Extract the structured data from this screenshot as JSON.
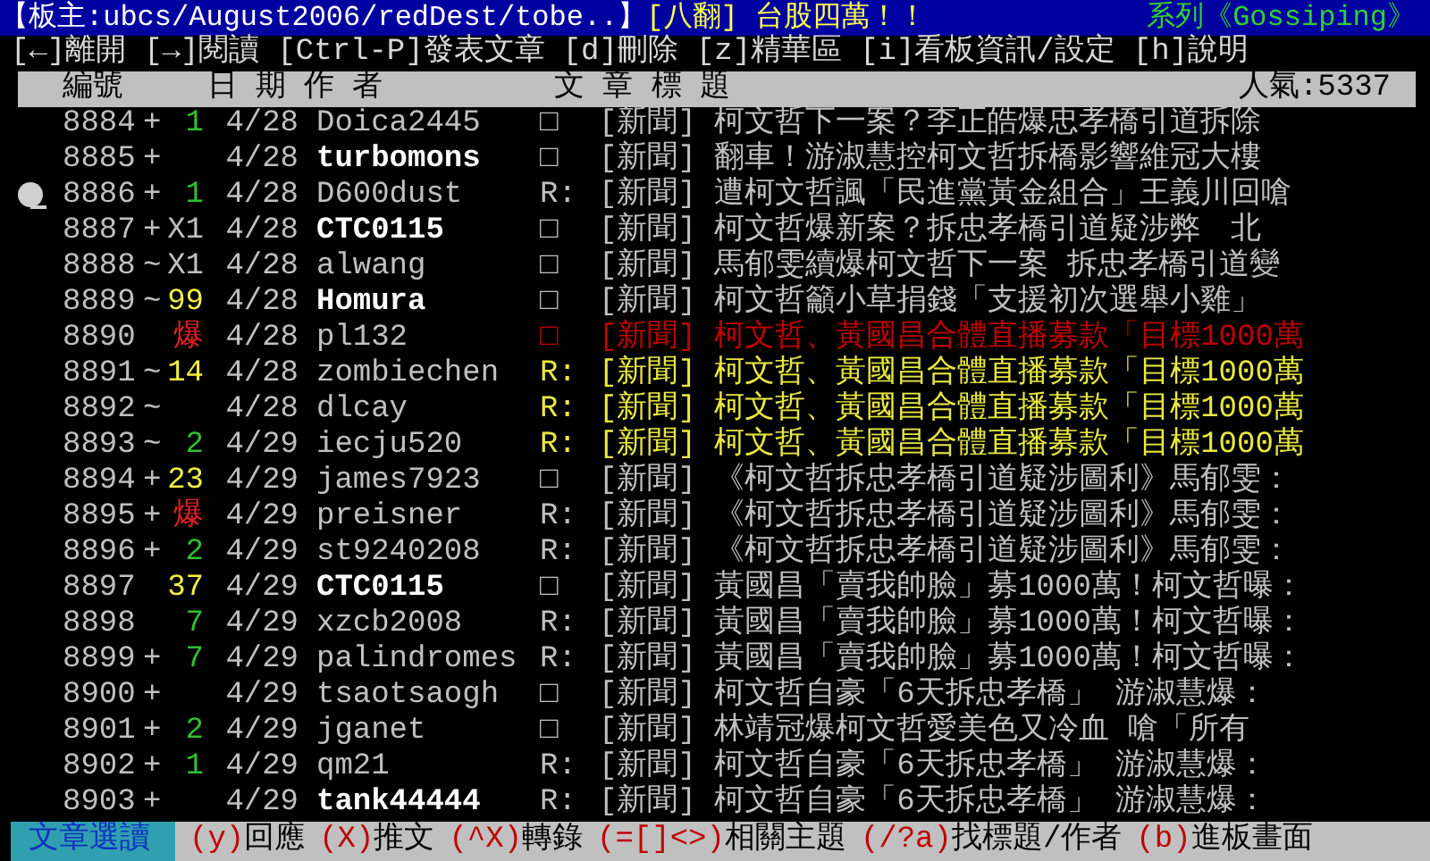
{
  "title_bar": {
    "moderator": "【板主:ubcs/August2006/redDest/tobe..】",
    "board_title": "[八翻] 台股四萬！！",
    "series": "系列《Gossiping》"
  },
  "menu": [
    "[←]離開",
    "[→]閱讀",
    "[Ctrl-P]發表文章",
    "[d]刪除",
    "[z]精華區",
    "[i]看板資訊/設定",
    "[h]說明"
  ],
  "header": {
    "number": "編號",
    "date": "日 期",
    "author": "作 者",
    "title": "文 章 標 題",
    "popularity": "人氣:5337"
  },
  "rows": [
    {
      "number": "8884",
      "push": {
        "mark": "+",
        "count": "1",
        "color": "#30c030"
      },
      "date": "4/28",
      "author": "Doica2445",
      "bright": false,
      "selected": false,
      "title": {
        "prefix": "□",
        "text": "[新聞] 柯文哲下一案？李正皓爆忠孝橋引道拆除",
        "color": "#c0c0c0"
      }
    },
    {
      "number": "8885",
      "push": {
        "mark": "+"
      },
      "date": "4/28",
      "author": "turbomons",
      "bright": true,
      "selected": false,
      "title": {
        "prefix": "□",
        "text": "[新聞] 翻車！游淑慧控柯文哲拆橋影響維冠大樓",
        "color": "#c0c0c0"
      }
    },
    {
      "number": "8886",
      "push": {
        "mark": "+",
        "count": "1",
        "color": "#30c030"
      },
      "date": "4/28",
      "author": "D600dust",
      "bright": false,
      "selected": true,
      "title": {
        "prefix": "R:",
        "text": "[新聞] 遭柯文哲諷「民進黨黃金組合」王義川回嗆",
        "color": "#c0c0c0"
      }
    },
    {
      "number": "8887",
      "push": {
        "mark": "+",
        "count": "X1",
        "color": "#c0c0c0"
      },
      "date": "4/28",
      "author": "CTC0115",
      "bright": true,
      "selected": false,
      "title": {
        "prefix": "□",
        "text": "[新聞] 柯文哲爆新案？拆忠孝橋引道疑涉弊　北",
        "color": "#c0c0c0"
      }
    },
    {
      "number": "8888",
      "push": {
        "mark": "~",
        "count": "X1",
        "color": "#c0c0c0"
      },
      "date": "4/28",
      "author": "alwang",
      "bright": false,
      "selected": false,
      "title": {
        "prefix": "□",
        "text": "[新聞] 馬郁雯續爆柯文哲下一案 拆忠孝橋引道變",
        "color": "#c0c0c0"
      }
    },
    {
      "number": "8889",
      "push": {
        "mark": "~",
        "count": "99",
        "color": "#f0f040"
      },
      "date": "4/28",
      "author": "Homura",
      "bright": true,
      "selected": false,
      "title": {
        "prefix": "□",
        "text": "[新聞] 柯文哲籲小草捐錢「支援初次選舉小雞」",
        "color": "#c0c0c0"
      }
    },
    {
      "number": "8890",
      "push": {
        "count": "爆",
        "color": "#e02020"
      },
      "date": "4/28",
      "author": "pl132",
      "bright": false,
      "selected": false,
      "title": {
        "prefix": "□",
        "text": "[新聞] 柯文哲、黃國昌合體直播募款「目標1000萬",
        "color": "#c00000"
      }
    },
    {
      "number": "8891",
      "push": {
        "mark": "~",
        "count": "14",
        "color": "#f0f040"
      },
      "date": "4/28",
      "author": "zombiechen",
      "bright": false,
      "selected": false,
      "title": {
        "prefix": "R:",
        "text": "[新聞] 柯文哲、黃國昌合體直播募款「目標1000萬",
        "color": "#e8e840"
      }
    },
    {
      "number": "8892",
      "push": {
        "mark": "~"
      },
      "date": "4/28",
      "author": "dlcay",
      "bright": false,
      "selected": false,
      "title": {
        "prefix": "R:",
        "text": "[新聞] 柯文哲、黃國昌合體直播募款「目標1000萬",
        "color": "#e8e840"
      }
    },
    {
      "number": "8893",
      "push": {
        "mark": "~",
        "count": "2",
        "color": "#30c030"
      },
      "date": "4/29",
      "author": "iecju520",
      "bright": false,
      "selected": false,
      "title": {
        "prefix": "R:",
        "text": "[新聞] 柯文哲、黃國昌合體直播募款「目標1000萬",
        "color": "#e8e840"
      }
    },
    {
      "number": "8894",
      "push": {
        "mark": "+",
        "count": "23",
        "color": "#f0f040"
      },
      "date": "4/29",
      "author": "james7923",
      "bright": false,
      "selected": false,
      "title": {
        "prefix": "□",
        "text": "[新聞] 《柯文哲拆忠孝橋引道疑涉圖利》馬郁雯：",
        "color": "#c0c0c0"
      }
    },
    {
      "number": "8895",
      "push": {
        "mark": "+",
        "count": "爆",
        "color": "#e02020"
      },
      "date": "4/29",
      "author": "preisner",
      "bright": false,
      "selected": false,
      "title": {
        "prefix": "R:",
        "text": "[新聞] 《柯文哲拆忠孝橋引道疑涉圖利》馬郁雯：",
        "color": "#c0c0c0"
      }
    },
    {
      "number": "8896",
      "push": {
        "mark": "+",
        "count": "2",
        "color": "#30c030"
      },
      "date": "4/29",
      "author": "st9240208",
      "bright": false,
      "selected": false,
      "title": {
        "prefix": "R:",
        "text": "[新聞] 《柯文哲拆忠孝橋引道疑涉圖利》馬郁雯：",
        "color": "#c0c0c0"
      }
    },
    {
      "number": "8897",
      "push": {
        "count": "37",
        "color": "#f0f040"
      },
      "date": "4/29",
      "author": "CTC0115",
      "bright": true,
      "selected": false,
      "title": {
        "prefix": "□",
        "text": "[新聞] 黃國昌「賣我帥臉」募1000萬！柯文哲曝：",
        "color": "#c0c0c0"
      }
    },
    {
      "number": "8898",
      "push": {
        "count": "7",
        "color": "#30c030"
      },
      "date": "4/29",
      "author": "xzcb2008",
      "bright": false,
      "selected": false,
      "title": {
        "prefix": "R:",
        "text": "[新聞] 黃國昌「賣我帥臉」募1000萬！柯文哲曝：",
        "color": "#c0c0c0"
      }
    },
    {
      "number": "8899",
      "push": {
        "mark": "+",
        "count": "7",
        "color": "#30c030"
      },
      "date": "4/29",
      "author": "palindromes",
      "bright": false,
      "selected": false,
      "title": {
        "prefix": "R:",
        "text": "[新聞] 黃國昌「賣我帥臉」募1000萬！柯文哲曝：",
        "color": "#c0c0c0"
      }
    },
    {
      "number": "8900",
      "push": {
        "mark": "+"
      },
      "date": "4/29",
      "author": "tsaotsaogh",
      "bright": false,
      "selected": false,
      "title": {
        "prefix": "□",
        "text": "[新聞] 柯文哲自豪「6天拆忠孝橋」 游淑慧爆：",
        "color": "#c0c0c0"
      }
    },
    {
      "number": "8901",
      "push": {
        "mark": "+",
        "count": "2",
        "color": "#30c030"
      },
      "date": "4/29",
      "author": "jganet",
      "bright": false,
      "selected": false,
      "title": {
        "prefix": "□",
        "text": "[新聞] 林靖冠爆柯文哲愛美色又冷血 嗆「所有",
        "color": "#c0c0c0"
      }
    },
    {
      "number": "8902",
      "push": {
        "mark": "+",
        "count": "1",
        "color": "#30c030"
      },
      "date": "4/29",
      "author": "qm21",
      "bright": false,
      "selected": false,
      "title": {
        "prefix": "R:",
        "text": "[新聞] 柯文哲自豪「6天拆忠孝橋」 游淑慧爆：",
        "color": "#c0c0c0"
      }
    },
    {
      "number": "8903",
      "push": {
        "mark": "+"
      },
      "date": "4/29",
      "author": "tank44444",
      "bright": true,
      "selected": false,
      "title": {
        "prefix": "R:",
        "text": "[新聞] 柯文哲自豪「6天拆忠孝橋」 游淑慧爆：",
        "color": "#c0c0c0"
      }
    }
  ],
  "footer": {
    "mode": "文章選讀",
    "hints": [
      {
        "key": "(y)",
        "label": "回應"
      },
      {
        "key": "(X)",
        "label": "推文"
      },
      {
        "key": "(^X)",
        "label": "轉錄"
      },
      {
        "key": "(=[]<>)",
        "label": "相關主題"
      },
      {
        "key": "(/?a)",
        "label": "找標題/作者"
      },
      {
        "key": "(b)",
        "label": "進板畫面"
      }
    ]
  }
}
